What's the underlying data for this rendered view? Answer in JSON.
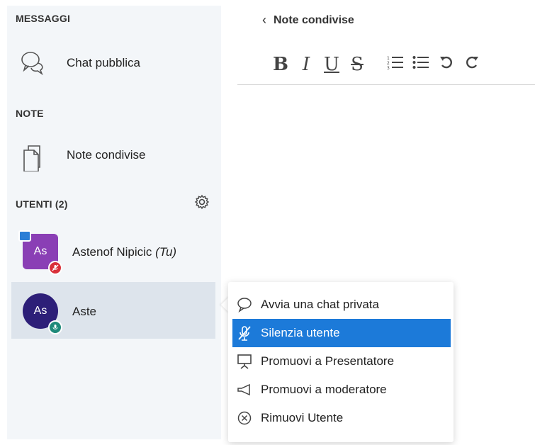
{
  "sidebar": {
    "messages_title": "MESSAGGI",
    "public_chat_label": "Chat pubblica",
    "notes_title": "NOTE",
    "shared_notes_label": "Note condivise",
    "users_title": "UTENTI (2)",
    "users": [
      {
        "initials": "As",
        "name": "Astenof Nipicic",
        "you_tag": "(Tu)"
      },
      {
        "initials": "As",
        "name": "Aste"
      }
    ]
  },
  "main": {
    "back_label": "Note condivise",
    "toolbar": {
      "bold": "B",
      "italic": "I",
      "underline": "U",
      "strike": "S"
    }
  },
  "context_menu": {
    "items": [
      {
        "label": "Avvia una chat privata",
        "icon": "chat-icon"
      },
      {
        "label": "Silenzia utente",
        "icon": "mic-muted-icon"
      },
      {
        "label": "Promuovi a Presentatore",
        "icon": "presentation-icon"
      },
      {
        "label": "Promuovi a moderatore",
        "icon": "megaphone-icon"
      },
      {
        "label": "Rimuovi Utente",
        "icon": "remove-icon"
      }
    ]
  },
  "colors": {
    "sidebar_bg": "#f3f6f9",
    "selected_row": "#dde4ec",
    "menu_active": "#1c7ad9",
    "avatar_purple": "#8a3fb5",
    "avatar_navy": "#2d1f78",
    "badge_red": "#d9303a",
    "badge_teal": "#1e8a7a"
  }
}
